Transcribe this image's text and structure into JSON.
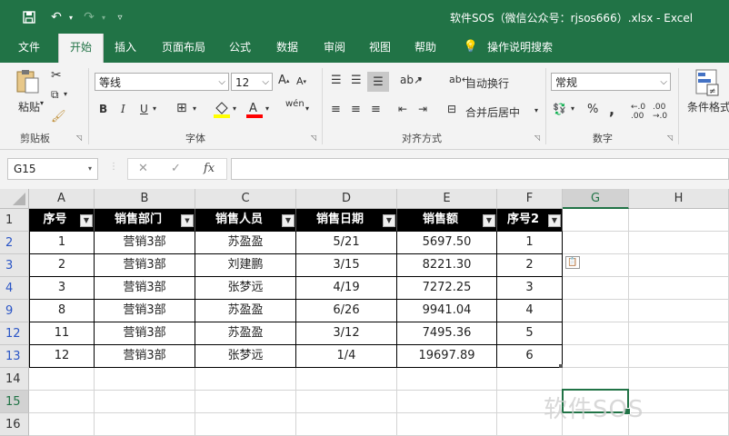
{
  "title_bar": {
    "title": "软件SOS（微信公众号：rjsos666）.xlsx  -  Excel",
    "save_icon": "save-icon",
    "undo_icon": "undo-icon",
    "redo_icon": "redo-icon",
    "customize_icon": "customize-qat-icon"
  },
  "tabs": [
    "文件",
    "开始",
    "插入",
    "页面布局",
    "公式",
    "数据",
    "审阅",
    "视图",
    "帮助",
    "操作说明搜索"
  ],
  "ribbon": {
    "clipboard": {
      "paste": "粘贴",
      "label": "剪贴板"
    },
    "font": {
      "name": "等线",
      "size": "12",
      "bold": "B",
      "italic": "I",
      "underline": "U",
      "label": "字体"
    },
    "alignment": {
      "wrap": "自动换行",
      "merge": "合并后居中",
      "label": "对齐方式"
    },
    "number": {
      "format": "常规",
      "percent": "%",
      "comma": ",",
      "label": "数字"
    },
    "styles": {
      "conditional": "条件格式"
    }
  },
  "formula_bar": {
    "name_box": "G15",
    "fx": "fx",
    "cancel": "✕",
    "enter": "✓"
  },
  "sheet": {
    "columns": [
      "A",
      "B",
      "C",
      "D",
      "E",
      "F",
      "G",
      "H"
    ],
    "row_numbers": [
      "1",
      "2",
      "3",
      "4",
      "9",
      "12",
      "13",
      "14",
      "15",
      "16"
    ],
    "headers": [
      "序号",
      "销售部门",
      "销售人员",
      "销售日期",
      "销售额",
      "序号2"
    ],
    "rows": [
      [
        "1",
        "营销3部",
        "苏盈盈",
        "5/21",
        "5697.50",
        "1"
      ],
      [
        "2",
        "营销3部",
        "刘建鹏",
        "3/15",
        "8221.30",
        "2"
      ],
      [
        "3",
        "营销3部",
        "张梦远",
        "4/19",
        "7272.25",
        "3"
      ],
      [
        "8",
        "营销3部",
        "苏盈盈",
        "6/26",
        "9941.04",
        "4"
      ],
      [
        "11",
        "营销3部",
        "苏盈盈",
        "3/12",
        "7495.36",
        "5"
      ],
      [
        "12",
        "营销3部",
        "张梦远",
        "1/4",
        "19697.89",
        "6"
      ]
    ]
  },
  "watermark": "软件SOS"
}
